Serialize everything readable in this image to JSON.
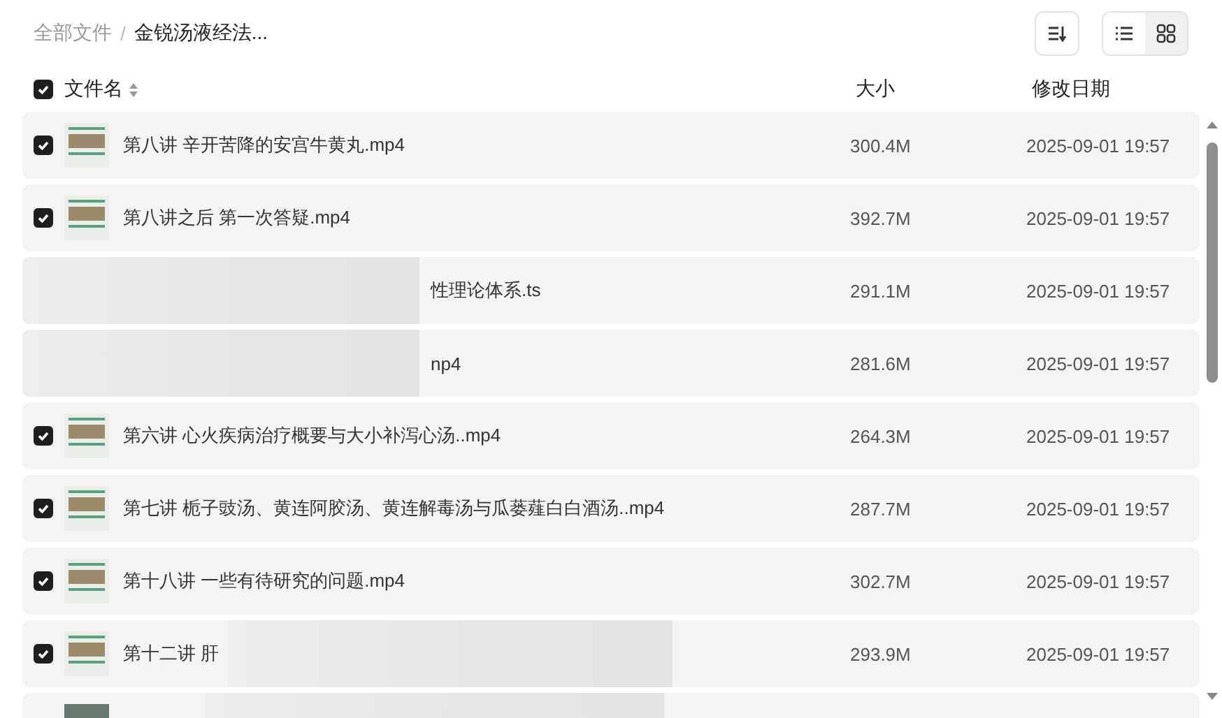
{
  "breadcrumb": [
    {
      "label": "全部文件",
      "current": false
    },
    {
      "label": "金锐汤液经法...",
      "current": true
    }
  ],
  "breadcrumb_separator": "/",
  "view_modes": [
    {
      "kind": "list",
      "selected": false
    },
    {
      "kind": "grid",
      "selected": true
    }
  ],
  "header": {
    "checked": true,
    "columns": [
      "文件名",
      "大小",
      "修改日期"
    ]
  },
  "rows": [
    {
      "kind": "file",
      "checked": true,
      "name": "第八讲 辛开苦降的安宫牛黄丸.mp4",
      "size": "300.4M",
      "modified": "2025-09-01 19:57"
    },
    {
      "kind": "file",
      "checked": true,
      "name": "第八讲之后 第一次答疑.mp4",
      "size": "392.7M",
      "modified": "2025-09-01 19:57"
    },
    {
      "kind": "partly_hidden",
      "name": "性理论体系.ts",
      "size": "291.1M",
      "modified": "2025-09-01 19:57"
    },
    {
      "kind": "partly_hidden",
      "name": "np4",
      "size": "281.6M",
      "modified": "2025-09-01 19:57"
    },
    {
      "kind": "file",
      "checked": true,
      "name": "第六讲 心火疾病治疗概要与大小补泻心汤..mp4",
      "size": "264.3M",
      "modified": "2025-09-01 19:57"
    },
    {
      "kind": "file",
      "checked": true,
      "name": "第七讲 栀子豉汤、黄连阿胶汤、黄连解毒汤与瓜蒌薤白白酒汤..mp4",
      "size": "287.7M",
      "modified": "2025-09-01 19:57"
    },
    {
      "kind": "file",
      "checked": true,
      "name": "第十八讲 一些有待研究的问题.mp4",
      "size": "302.7M",
      "modified": "2025-09-01 19:57"
    },
    {
      "kind": "file_hidden_tail",
      "checked": true,
      "name": "第十二讲 肝",
      "size": "293.9M",
      "modified": "2025-09-01 19:57"
    },
    {
      "kind": "cut"
    }
  ]
}
